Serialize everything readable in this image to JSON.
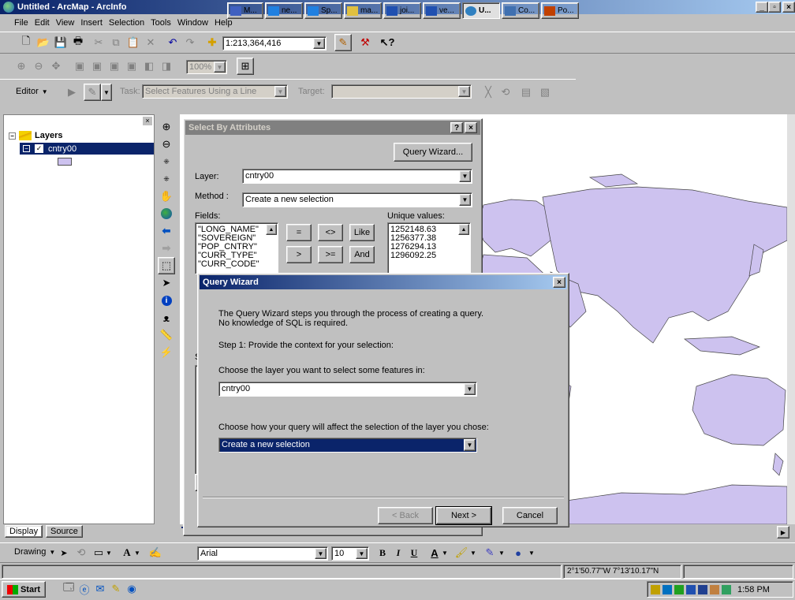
{
  "app": {
    "title": "Untitled - ArcMap - ArcInfo"
  },
  "menu": [
    "File",
    "Edit",
    "View",
    "Insert",
    "Selection",
    "Tools",
    "Window",
    "Help"
  ],
  "toolbar": {
    "scale": "1:213,364,416",
    "zoom": "100%"
  },
  "editor": {
    "label": "Editor",
    "task_label": "Task:",
    "task_value": "Select Features Using a Line",
    "target_label": "Target:",
    "target_value": ""
  },
  "toc": {
    "root": "Layers",
    "layer": "cntry00",
    "tab_display": "Display",
    "tab_source": "Source"
  },
  "sba": {
    "title": "Select By Attributes",
    "help": "?",
    "close": "×",
    "query_wizard_btn": "Query Wizard...",
    "layer_label": "Layer:",
    "layer_value": "cntry00",
    "method_label": "Method :",
    "method_value": "Create a new selection",
    "fields_label": "Fields:",
    "fields": [
      "\"LONG_NAME\"",
      "\"SOVEREIGN\"",
      "\"POP_CNTRY\"",
      "\"CURR_TYPE\"",
      "\"CURR_CODE\""
    ],
    "ops": [
      "=",
      "<>",
      "Like",
      ">",
      ">=",
      "And"
    ],
    "unique_label": "Unique values:",
    "unique_values": [
      "1252148.63",
      "1256377.38",
      "1276294.13",
      "1296092.25"
    ],
    "partial_s": "S"
  },
  "qw": {
    "title": "Query Wizard",
    "close": "×",
    "intro1": "The Query Wizard steps you through the process of creating a query.",
    "intro2": "No knowledge of SQL is required.",
    "step1": "Step 1: Provide the context for your selection:",
    "choose_layer": "Choose the layer you want to select some features in:",
    "layer_value": "cntry00",
    "choose_query": "Choose how your query will affect the selection of the layer you chose:",
    "query_value": "Create a new selection",
    "back": "< Back",
    "next": "Next >",
    "cancel": "Cancel"
  },
  "drawing": {
    "label": "Drawing",
    "font": "Arial",
    "size": "10",
    "bold": "B",
    "italic": "I",
    "underline": "U",
    "font_color": "A"
  },
  "status": {
    "coords": "2°1'50.77\"W  7°13'10.17\"N"
  },
  "taskbar": {
    "start": "Start",
    "tasks": [
      "M...",
      "ne...",
      "Sp...",
      "ma...",
      "joi...",
      "ve...",
      "U...",
      "Co...",
      "Po..."
    ],
    "clock": "1:58 PM"
  },
  "colors": {
    "title_active": "#0a246a",
    "title_gradient": "#a6caf0",
    "title_inactive": "#808080",
    "map_fill": "#cdc2ef",
    "selected": "#0a246a"
  }
}
